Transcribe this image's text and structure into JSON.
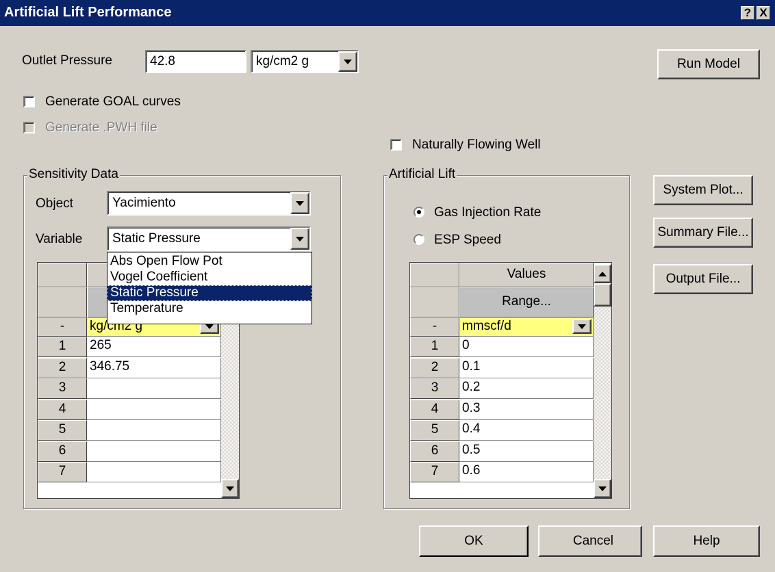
{
  "window": {
    "title": "Artificial Lift Performance",
    "help_glyph": "?",
    "close_glyph": "X"
  },
  "outlet": {
    "label": "Outlet Pressure",
    "value": "42.8",
    "unit": "kg/cm2 g"
  },
  "checkboxes": {
    "goal": {
      "label": "Generate GOAL curves",
      "checked": false
    },
    "pwh": {
      "label": "Generate .PWH file",
      "checked": false,
      "disabled": true
    },
    "natural": {
      "label": "Naturally Flowing Well",
      "checked": false
    }
  },
  "buttons": {
    "run_model": "Run Model",
    "system_plot": "System Plot...",
    "summary_file": "Summary File...",
    "output_file": "Output File...",
    "ok": "OK",
    "cancel": "Cancel",
    "help": "Help"
  },
  "sensitivity": {
    "legend": "Sensitivity Data",
    "object_label": "Object",
    "object_value": "Yacimiento",
    "variable_label": "Variable",
    "variable_value": "Static Pressure",
    "dropdown_options": [
      "Abs Open Flow Pot",
      "Vogel Coefficient",
      "Static Pressure",
      "Temperature"
    ],
    "unit_row_label": "-",
    "unit": "kg/cm2 g",
    "rows": [
      {
        "n": "1",
        "v": "265"
      },
      {
        "n": "2",
        "v": "346.75"
      },
      {
        "n": "3",
        "v": ""
      },
      {
        "n": "4",
        "v": ""
      },
      {
        "n": "5",
        "v": ""
      },
      {
        "n": "6",
        "v": ""
      },
      {
        "n": "7",
        "v": ""
      }
    ]
  },
  "artificial_lift": {
    "legend": "Artificial Lift",
    "radio_gas": "Gas Injection Rate",
    "radio_esp": "ESP Speed",
    "selected": "Gas Injection Rate",
    "table_header": "Values",
    "range_button": "Range...",
    "unit_row_label": "-",
    "unit": "mmscf/d",
    "rows": [
      {
        "n": "1",
        "v": "0"
      },
      {
        "n": "2",
        "v": "0.1"
      },
      {
        "n": "3",
        "v": "0.2"
      },
      {
        "n": "4",
        "v": "0.3"
      },
      {
        "n": "5",
        "v": "0.4"
      },
      {
        "n": "6",
        "v": "0.5"
      },
      {
        "n": "7",
        "v": "0.6"
      }
    ]
  },
  "colors": {
    "titlebar": "#0a246a",
    "face": "#d4d0c8",
    "unit_cell": "#ffff80",
    "selection": "#0a246a"
  }
}
